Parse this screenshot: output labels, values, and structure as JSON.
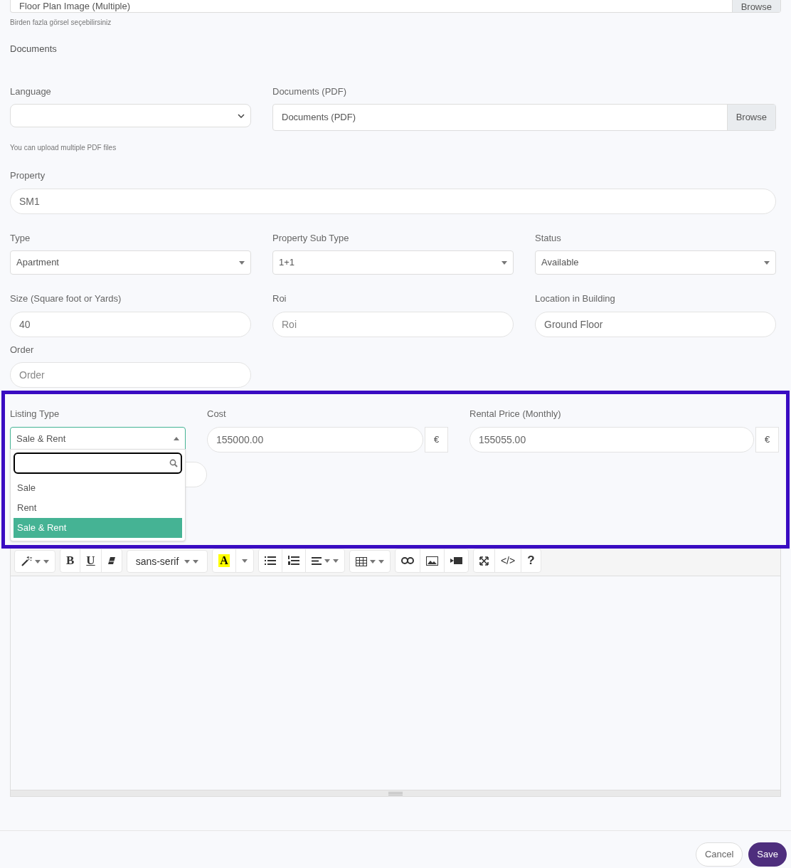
{
  "floor_plan": {
    "value": "Floor Plan Image (Multiple)",
    "button": "Browse",
    "hint": "Birden fazla görsel seçebilirsiniz"
  },
  "documents_heading": "Documents",
  "language": {
    "label": "Language"
  },
  "documents_pdf": {
    "label": "Documents (PDF)",
    "value": "Documents (PDF)",
    "button": "Browse"
  },
  "pdf_hint": "You can upload multiple PDF files",
  "property": {
    "label": "Property",
    "value": "SM1"
  },
  "selects": [
    {
      "label": "Type",
      "value": "Apartment"
    },
    {
      "label": "Property Sub Type",
      "value": "1+1"
    },
    {
      "label": "Status",
      "value": "Available"
    }
  ],
  "fields": [
    {
      "label": "Size (Square foot or Yards)",
      "value": "40"
    },
    {
      "label": "Roi",
      "placeholder": "Roi"
    },
    {
      "label": "Location in Building",
      "value": "Ground Floor"
    }
  ],
  "order": {
    "label": "Order",
    "placeholder": "Order"
  },
  "listing_type": {
    "label": "Listing Type",
    "value": "Sale & Rent",
    "expanded": true,
    "options": [
      {
        "label": "Sale",
        "selected": false
      },
      {
        "label": "Rent",
        "selected": false
      },
      {
        "label": "Sale & Rent",
        "selected": true
      }
    ]
  },
  "cost": {
    "label": "Cost",
    "value": "155000.00",
    "unit": "€"
  },
  "rental_price": {
    "label": "Rental Price (Monthly)",
    "value": "155055.00",
    "unit": "€"
  },
  "editor": {
    "font": "sans-serif",
    "bold": "B",
    "underline": "U",
    "highlight": "A",
    "code": "</>",
    "help": "?"
  },
  "buttons": {
    "cancel": "Cancel",
    "save": "Save"
  }
}
